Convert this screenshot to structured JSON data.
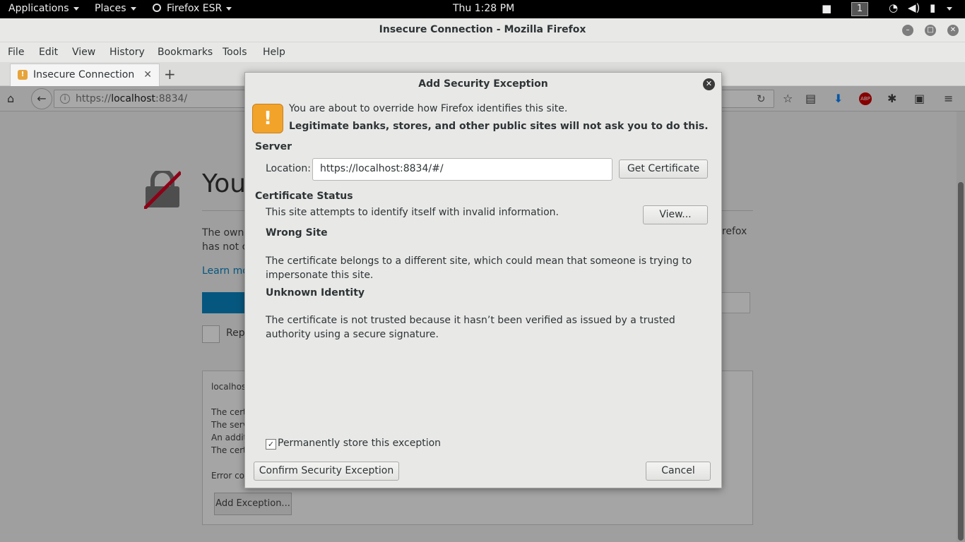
{
  "topbar": {
    "applications": "Applications",
    "places": "Places",
    "app": "Firefox ESR",
    "clock": "Thu  1:28 PM",
    "workspace": "1"
  },
  "window": {
    "title": "Insecure Connection - Mozilla Firefox"
  },
  "menu": {
    "file": "File",
    "edit": "Edit",
    "view": "View",
    "history": "History",
    "bookmarks": "Bookmarks",
    "tools": "Tools",
    "help": "Help"
  },
  "tab": {
    "label": "Insecure Connection",
    "close": "✕",
    "new": "+"
  },
  "nav": {
    "url_prefix": "https://",
    "url_host": "localhost",
    "url_suffix": ":8834/"
  },
  "page": {
    "heading": "You",
    "text_line1": "The owne",
    "text_line2": "has not c",
    "text_right": "irefox",
    "learn_more": "Learn mo",
    "report": "Rep",
    "box_host": "localhos",
    "box_l1": "The cert",
    "box_l2": "The serv",
    "box_l3": "An addit",
    "box_l4": "The cert",
    "box_error": "Error co",
    "add_exception": "Add Exception..."
  },
  "dialog": {
    "title": "Add Security Exception",
    "intro": "You are about to override how Firefox identifies this site.",
    "warning": "Legitimate banks, stores, and other public sites will not ask you to do this.",
    "server_header": "Server",
    "location_label": "Location:",
    "location_value": "https://localhost:8834/#/",
    "get_certificate": "Get Certificate",
    "cert_status_header": "Certificate Status",
    "cert_status_text": "This site attempts to identify itself with invalid information.",
    "view_button": "View...",
    "wrong_site_header": "Wrong Site",
    "wrong_site_text": "The certificate belongs to a different site, which could mean that someone is trying to impersonate this site.",
    "unknown_identity_header": "Unknown Identity",
    "unknown_identity_text": "The certificate is not trusted because it hasn’t been verified as issued by a trusted authority using a secure signature.",
    "permanent_label": "Permanently store this exception",
    "permanent_checked": true,
    "confirm_button": "Confirm Security Exception",
    "cancel_button": "Cancel"
  },
  "colors": {
    "accent": "#0a84c1",
    "warning_icon": "#f2a32a",
    "topbar": "#000000"
  }
}
